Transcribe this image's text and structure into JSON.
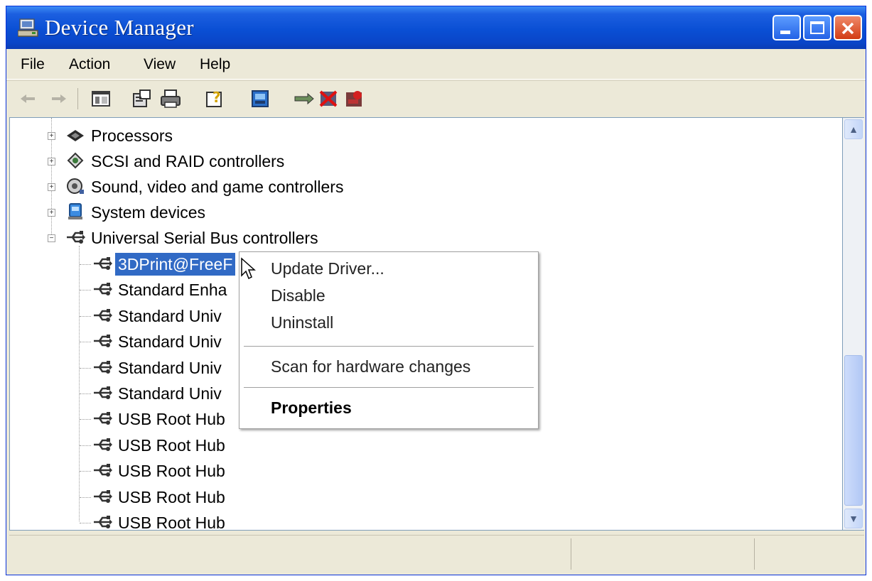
{
  "window": {
    "title": "Device Manager"
  },
  "menu": [
    "File",
    "Action",
    "View",
    "Help"
  ],
  "toolbar": [
    "back-icon",
    "forward-icon",
    "console-tree-icon",
    "properties-icon",
    "print-icon",
    "help-icon",
    "scan-icon",
    "update-driver-icon",
    "disable-icon",
    "uninstall-icon"
  ],
  "tree": {
    "categories": [
      {
        "label": "Processors",
        "icon": "processor-icon",
        "expanded": false
      },
      {
        "label": "SCSI and RAID controllers",
        "icon": "scsi-icon",
        "expanded": false
      },
      {
        "label": "Sound, video and game controllers",
        "icon": "sound-icon",
        "expanded": false
      },
      {
        "label": "System devices",
        "icon": "system-icon",
        "expanded": false
      },
      {
        "label": "Universal Serial Bus controllers",
        "icon": "usb-icon",
        "expanded": true
      }
    ],
    "usb_children": [
      {
        "label": "3DPrint@FreeF",
        "selected": true
      },
      {
        "label": "Standard Enha"
      },
      {
        "label": "Standard Univ"
      },
      {
        "label": "Standard Univ"
      },
      {
        "label": "Standard Univ"
      },
      {
        "label": "Standard Univ"
      },
      {
        "label": "USB Root Hub"
      },
      {
        "label": "USB Root Hub"
      },
      {
        "label": "USB Root Hub"
      },
      {
        "label": "USB Root Hub"
      },
      {
        "label": "USB Root Hub"
      }
    ]
  },
  "context_menu": {
    "update_driver": "Update Driver...",
    "disable": "Disable",
    "uninstall": "Uninstall",
    "scan": "Scan for hardware changes",
    "properties": "Properties"
  },
  "colors": {
    "titlebar": "#0a4fd4",
    "selection": "#316ac5",
    "chrome": "#ece9d8"
  }
}
